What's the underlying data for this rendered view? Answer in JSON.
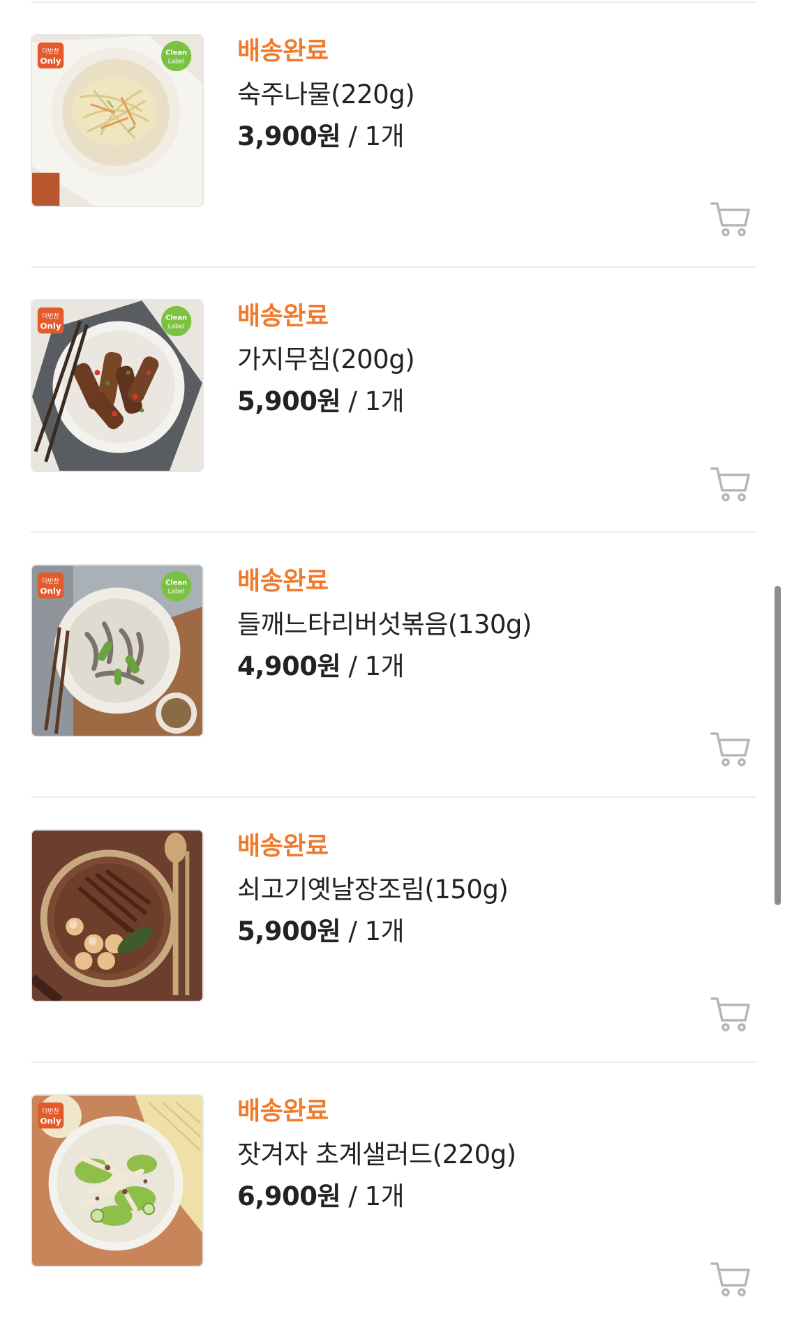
{
  "orders": [
    {
      "status": "배송완료",
      "name": "숙주나물(220g)",
      "price": "3,900원",
      "separator": " / ",
      "quantity": "1개",
      "image": "bean-sprouts-dish",
      "badges": [
        "더반찬 Only",
        "Clean Label"
      ]
    },
    {
      "status": "배송완료",
      "name": "가지무침(200g)",
      "price": "5,900원",
      "separator": " / ",
      "quantity": "1개",
      "image": "seasoned-eggplant-dish",
      "badges": [
        "더반찬 Only",
        "Clean Label"
      ]
    },
    {
      "status": "배송완료",
      "name": "들깨느타리버섯볶음(130g)",
      "price": "4,900원",
      "separator": " / ",
      "quantity": "1개",
      "image": "perilla-mushroom-dish",
      "badges": [
        "더반찬 Only",
        "Clean Label"
      ]
    },
    {
      "status": "배송완료",
      "name": "쇠고기옛날장조림(150g)",
      "price": "5,900원",
      "separator": " / ",
      "quantity": "1개",
      "image": "beef-jangjorim-dish",
      "badges": []
    },
    {
      "status": "배송완료",
      "name": "잣겨자 초계샐러드(220g)",
      "price": "6,900원",
      "separator": " / ",
      "quantity": "1개",
      "image": "chicken-salad-dish",
      "badges": [
        "더반찬 Only"
      ]
    }
  ],
  "icons": {
    "cart": "cart-icon"
  },
  "colors": {
    "status": "#ef7a2c",
    "text": "#222222",
    "divider": "#ececec",
    "cart_icon": "#b5b5b5",
    "only_badge": "#e35a2b",
    "clean_badge": "#7cc242"
  }
}
